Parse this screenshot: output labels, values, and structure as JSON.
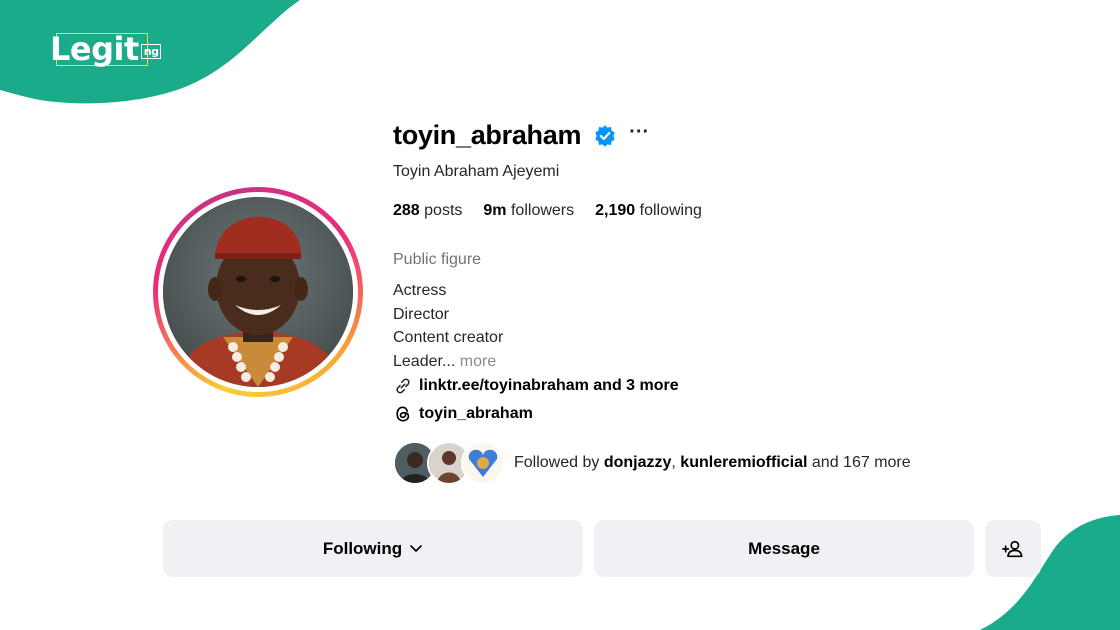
{
  "branding": {
    "logo_text": "Legit",
    "logo_suffix": "ng",
    "brand_color": "#1aab8a"
  },
  "profile": {
    "username": "toyin_abraham",
    "full_name": "Toyin Abraham Ajeyemi",
    "verified": true,
    "more_options_label": "···",
    "stats": {
      "posts_count": "288",
      "posts_label": "posts",
      "followers_count": "9m",
      "followers_label": "followers",
      "following_count": "2,190",
      "following_label": "following"
    },
    "category": "Public figure",
    "bio_lines": [
      "Actress",
      "Director",
      "Content creator",
      "Leader..."
    ],
    "bio_more": "more",
    "link_text": "linktr.ee/toyinabraham and 3 more",
    "threads_handle": "toyin_abraham",
    "followed_by": {
      "prefix": "Followed by",
      "user1": "donjazzy",
      "separator": ",",
      "user2": "kunleremiofficial",
      "suffix": "and 167 more"
    }
  },
  "actions": {
    "following_label": "Following",
    "message_label": "Message",
    "add_user_icon": "add-user-icon"
  },
  "colors": {
    "verified_blue": "#0095f6",
    "button_bg": "#eff1f4",
    "muted_text": "#737373"
  }
}
